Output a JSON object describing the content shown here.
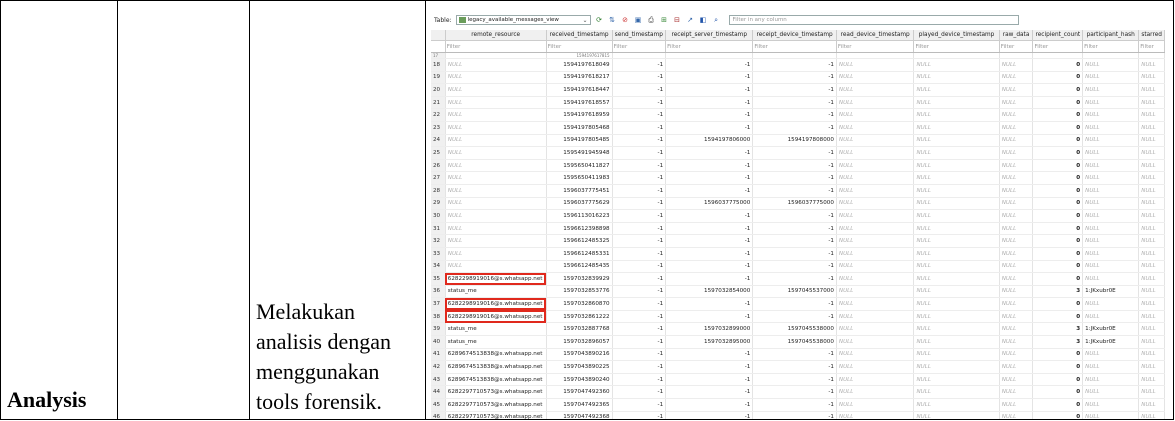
{
  "doc": {
    "analysis_label": "Analysis",
    "description": "Melakukan analisis dengan menggunakan tools forensik."
  },
  "toolbar": {
    "table_label": "Table:",
    "table_value": "legacy_available_messages_view",
    "filter_all_placeholder": "Filter in any column",
    "icons": [
      "refresh-icon",
      "clear-sort-icon",
      "filter-clear-icon",
      "save-icon",
      "print-icon",
      "insert-row-icon",
      "delete-row-icon",
      "goto-icon",
      "sql-icon",
      "find-icon"
    ]
  },
  "columns": [
    "",
    "remote_resource",
    "received_timestamp",
    "send_timestamp",
    "receipt_server_timestamp",
    "receipt_device_timestamp",
    "read_device_timestamp",
    "played_device_timestamp",
    "raw_data",
    "recipient_count",
    "participant_hash",
    "starred"
  ],
  "filter_placeholder": "Filter",
  "null_text": "NULL",
  "partial_row": {
    "n": "17",
    "received": "1594197617815"
  },
  "rows": [
    {
      "n": "18",
      "res": "",
      "recv": "1594197618049",
      "send": "-1",
      "rsrv": "-1",
      "rdev": "-1",
      "read": "",
      "play": "",
      "raw": "",
      "cnt": "0",
      "hash": "",
      "star": ""
    },
    {
      "n": "19",
      "res": "",
      "recv": "1594197618217",
      "send": "-1",
      "rsrv": "-1",
      "rdev": "-1",
      "read": "",
      "play": "",
      "raw": "",
      "cnt": "0",
      "hash": "",
      "star": ""
    },
    {
      "n": "20",
      "res": "",
      "recv": "1594197618447",
      "send": "-1",
      "rsrv": "-1",
      "rdev": "-1",
      "read": "",
      "play": "",
      "raw": "",
      "cnt": "0",
      "hash": "",
      "star": ""
    },
    {
      "n": "21",
      "res": "",
      "recv": "1594197618557",
      "send": "-1",
      "rsrv": "-1",
      "rdev": "-1",
      "read": "",
      "play": "",
      "raw": "",
      "cnt": "0",
      "hash": "",
      "star": ""
    },
    {
      "n": "22",
      "res": "",
      "recv": "1594197618959",
      "send": "-1",
      "rsrv": "-1",
      "rdev": "-1",
      "read": "",
      "play": "",
      "raw": "",
      "cnt": "0",
      "hash": "",
      "star": ""
    },
    {
      "n": "23",
      "res": "",
      "recv": "1594197805468",
      "send": "-1",
      "rsrv": "-1",
      "rdev": "-1",
      "read": "",
      "play": "",
      "raw": "",
      "cnt": "0",
      "hash": "",
      "star": ""
    },
    {
      "n": "24",
      "res": "",
      "recv": "1594197805485",
      "send": "-1",
      "rsrv": "1594197806000",
      "rdev": "1594197808000",
      "read": "",
      "play": "",
      "raw": "",
      "cnt": "0",
      "hash": "",
      "star": ""
    },
    {
      "n": "25",
      "res": "",
      "recv": "1595491945948",
      "send": "-1",
      "rsrv": "-1",
      "rdev": "-1",
      "read": "",
      "play": "",
      "raw": "",
      "cnt": "0",
      "hash": "",
      "star": ""
    },
    {
      "n": "26",
      "res": "",
      "recv": "1595650411827",
      "send": "-1",
      "rsrv": "-1",
      "rdev": "-1",
      "read": "",
      "play": "",
      "raw": "",
      "cnt": "0",
      "hash": "",
      "star": ""
    },
    {
      "n": "27",
      "res": "",
      "recv": "1595650411983",
      "send": "-1",
      "rsrv": "-1",
      "rdev": "-1",
      "read": "",
      "play": "",
      "raw": "",
      "cnt": "0",
      "hash": "",
      "star": ""
    },
    {
      "n": "28",
      "res": "",
      "recv": "1596037775451",
      "send": "-1",
      "rsrv": "-1",
      "rdev": "-1",
      "read": "",
      "play": "",
      "raw": "",
      "cnt": "0",
      "hash": "",
      "star": ""
    },
    {
      "n": "29",
      "res": "",
      "recv": "1596037775629",
      "send": "-1",
      "rsrv": "1596037775000",
      "rdev": "1596037775000",
      "read": "",
      "play": "",
      "raw": "",
      "cnt": "0",
      "hash": "",
      "star": ""
    },
    {
      "n": "30",
      "res": "",
      "recv": "1596113016223",
      "send": "-1",
      "rsrv": "-1",
      "rdev": "-1",
      "read": "",
      "play": "",
      "raw": "",
      "cnt": "0",
      "hash": "",
      "star": ""
    },
    {
      "n": "31",
      "res": "",
      "recv": "1596612398898",
      "send": "-1",
      "rsrv": "-1",
      "rdev": "-1",
      "read": "",
      "play": "",
      "raw": "",
      "cnt": "0",
      "hash": "",
      "star": ""
    },
    {
      "n": "32",
      "res": "",
      "recv": "1596612485325",
      "send": "-1",
      "rsrv": "-1",
      "rdev": "-1",
      "read": "",
      "play": "",
      "raw": "",
      "cnt": "0",
      "hash": "",
      "star": ""
    },
    {
      "n": "33",
      "res": "",
      "recv": "1596612485331",
      "send": "-1",
      "rsrv": "-1",
      "rdev": "-1",
      "read": "",
      "play": "",
      "raw": "",
      "cnt": "0",
      "hash": "",
      "star": ""
    },
    {
      "n": "34",
      "res": "",
      "recv": "1596612485435",
      "send": "-1",
      "rsrv": "-1",
      "rdev": "-1",
      "read": "",
      "play": "",
      "raw": "",
      "cnt": "0",
      "hash": "",
      "star": ""
    },
    {
      "n": "35",
      "res": "6282298919016@s.whatsapp.net",
      "recv": "1597032839929",
      "send": "-1",
      "rsrv": "-1",
      "rdev": "-1",
      "read": "",
      "play": "",
      "raw": "",
      "cnt": "0",
      "hash": "",
      "star": "",
      "hl": true
    },
    {
      "n": "36",
      "res": "status_me",
      "recv": "1597032853776",
      "send": "-1",
      "rsrv": "1597032854000",
      "rdev": "1597045537000",
      "read": "",
      "play": "",
      "raw": "",
      "cnt": "3",
      "hash": "1:JKxubr0E",
      "star": ""
    },
    {
      "n": "37",
      "res": "6282298919016@s.whatsapp.net",
      "recv": "1597032860870",
      "send": "-1",
      "rsrv": "-1",
      "rdev": "-1",
      "read": "",
      "play": "",
      "raw": "",
      "cnt": "0",
      "hash": "",
      "star": "",
      "hl": true
    },
    {
      "n": "38",
      "res": "6282298919016@s.whatsapp.net",
      "recv": "1597032861222",
      "send": "-1",
      "rsrv": "-1",
      "rdev": "-1",
      "read": "",
      "play": "",
      "raw": "",
      "cnt": "0",
      "hash": "",
      "star": "",
      "hl": true
    },
    {
      "n": "39",
      "res": "status_me",
      "recv": "1597032887768",
      "send": "-1",
      "rsrv": "1597032899000",
      "rdev": "1597045538000",
      "read": "",
      "play": "",
      "raw": "",
      "cnt": "3",
      "hash": "1:JKxubr0E",
      "star": ""
    },
    {
      "n": "40",
      "res": "status_me",
      "recv": "1597032896057",
      "send": "-1",
      "rsrv": "1597032895000",
      "rdev": "1597045538000",
      "read": "",
      "play": "",
      "raw": "",
      "cnt": "3",
      "hash": "1:JKxubr0E",
      "star": ""
    },
    {
      "n": "41",
      "res": "6289674513838@s.whatsapp.net",
      "recv": "1597043890216",
      "send": "-1",
      "rsrv": "-1",
      "rdev": "-1",
      "read": "",
      "play": "",
      "raw": "",
      "cnt": "0",
      "hash": "",
      "star": ""
    },
    {
      "n": "42",
      "res": "6289674513838@s.whatsapp.net",
      "recv": "1597043890225",
      "send": "-1",
      "rsrv": "-1",
      "rdev": "-1",
      "read": "",
      "play": "",
      "raw": "",
      "cnt": "0",
      "hash": "",
      "star": ""
    },
    {
      "n": "43",
      "res": "6289674513838@s.whatsapp.net",
      "recv": "1597043890240",
      "send": "-1",
      "rsrv": "-1",
      "rdev": "-1",
      "read": "",
      "play": "",
      "raw": "",
      "cnt": "0",
      "hash": "",
      "star": ""
    },
    {
      "n": "44",
      "res": "6282297710573@s.whatsapp.net",
      "recv": "1597047492360",
      "send": "-1",
      "rsrv": "-1",
      "rdev": "-1",
      "read": "",
      "play": "",
      "raw": "",
      "cnt": "0",
      "hash": "",
      "star": ""
    },
    {
      "n": "45",
      "res": "6282297710573@s.whatsapp.net",
      "recv": "1597047492365",
      "send": "-1",
      "rsrv": "-1",
      "rdev": "-1",
      "read": "",
      "play": "",
      "raw": "",
      "cnt": "0",
      "hash": "",
      "star": ""
    },
    {
      "n": "46",
      "res": "6282297710573@s.whatsapp.net",
      "recv": "1597047492368",
      "send": "-1",
      "rsrv": "-1",
      "rdev": "-1",
      "read": "",
      "play": "",
      "raw": "",
      "cnt": "0",
      "hash": "",
      "star": ""
    }
  ]
}
